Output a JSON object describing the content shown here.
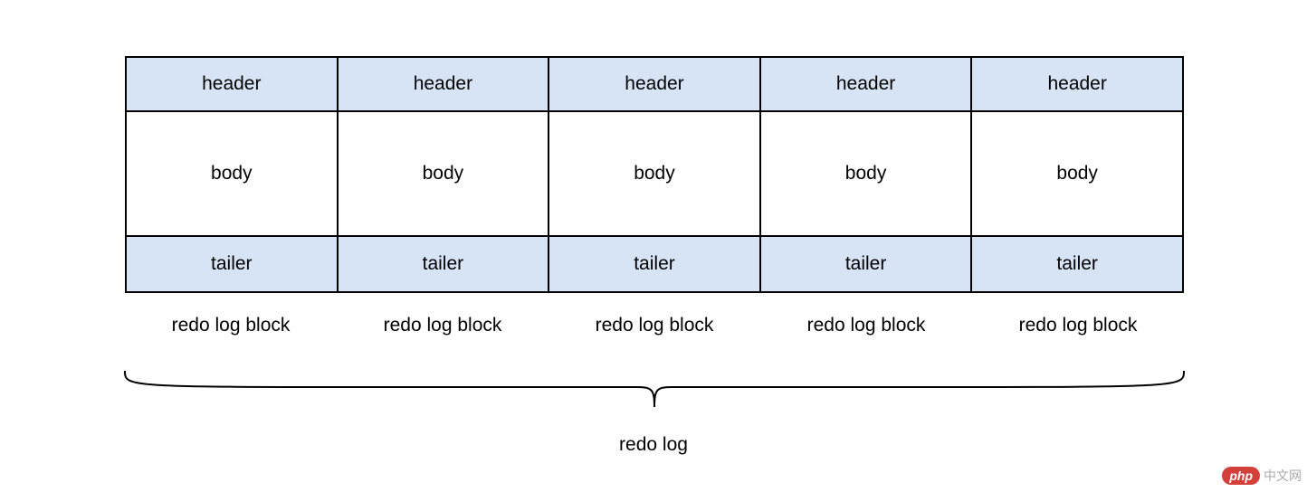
{
  "blocks": [
    {
      "header": "header",
      "body": "body",
      "tailer": "tailer",
      "label": "redo log block"
    },
    {
      "header": "header",
      "body": "body",
      "tailer": "tailer",
      "label": "redo log block"
    },
    {
      "header": "header",
      "body": "body",
      "tailer": "tailer",
      "label": "redo log block"
    },
    {
      "header": "header",
      "body": "body",
      "tailer": "tailer",
      "label": "redo log block"
    },
    {
      "header": "header",
      "body": "body",
      "tailer": "tailer",
      "label": "redo log block"
    }
  ],
  "overall_label": "redo log",
  "watermark": {
    "badge": "php",
    "text": "中文网"
  },
  "colors": {
    "shaded": "#d7e4f5",
    "border": "#000000"
  }
}
